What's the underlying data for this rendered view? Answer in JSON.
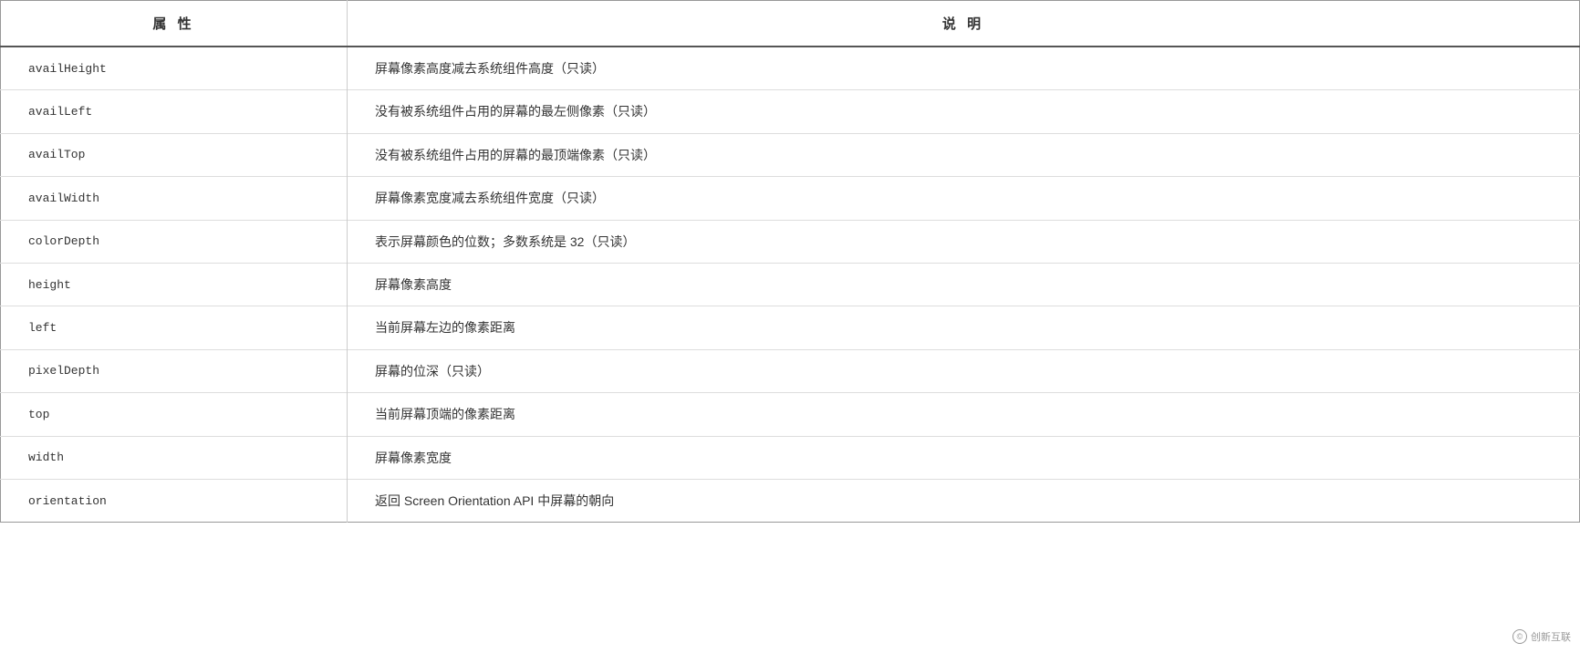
{
  "table": {
    "headers": {
      "property": "属  性",
      "description": "说  明"
    },
    "rows": [
      {
        "property": "availHeight",
        "description": "屏幕像素高度减去系统组件高度（只读）"
      },
      {
        "property": "availLeft",
        "description": "没有被系统组件占用的屏幕的最左侧像素（只读）"
      },
      {
        "property": "availTop",
        "description": "没有被系统组件占用的屏幕的最顶端像素（只读）"
      },
      {
        "property": "availWidth",
        "description": "屏幕像素宽度减去系统组件宽度（只读）"
      },
      {
        "property": "colorDepth",
        "description": "表示屏幕颜色的位数；多数系统是 32（只读）"
      },
      {
        "property": "height",
        "description": "屏幕像素高度"
      },
      {
        "property": "left",
        "description": "当前屏幕左边的像素距离"
      },
      {
        "property": "pixelDepth",
        "description": "屏幕的位深（只读）"
      },
      {
        "property": "top",
        "description": "当前屏幕顶端的像素距离"
      },
      {
        "property": "width",
        "description": "屏幕像素宽度"
      },
      {
        "property": "orientation",
        "description": "返回 Screen Orientation API 中屏幕的朝向"
      }
    ]
  },
  "watermark": {
    "icon": "©",
    "text": "创新互联"
  }
}
